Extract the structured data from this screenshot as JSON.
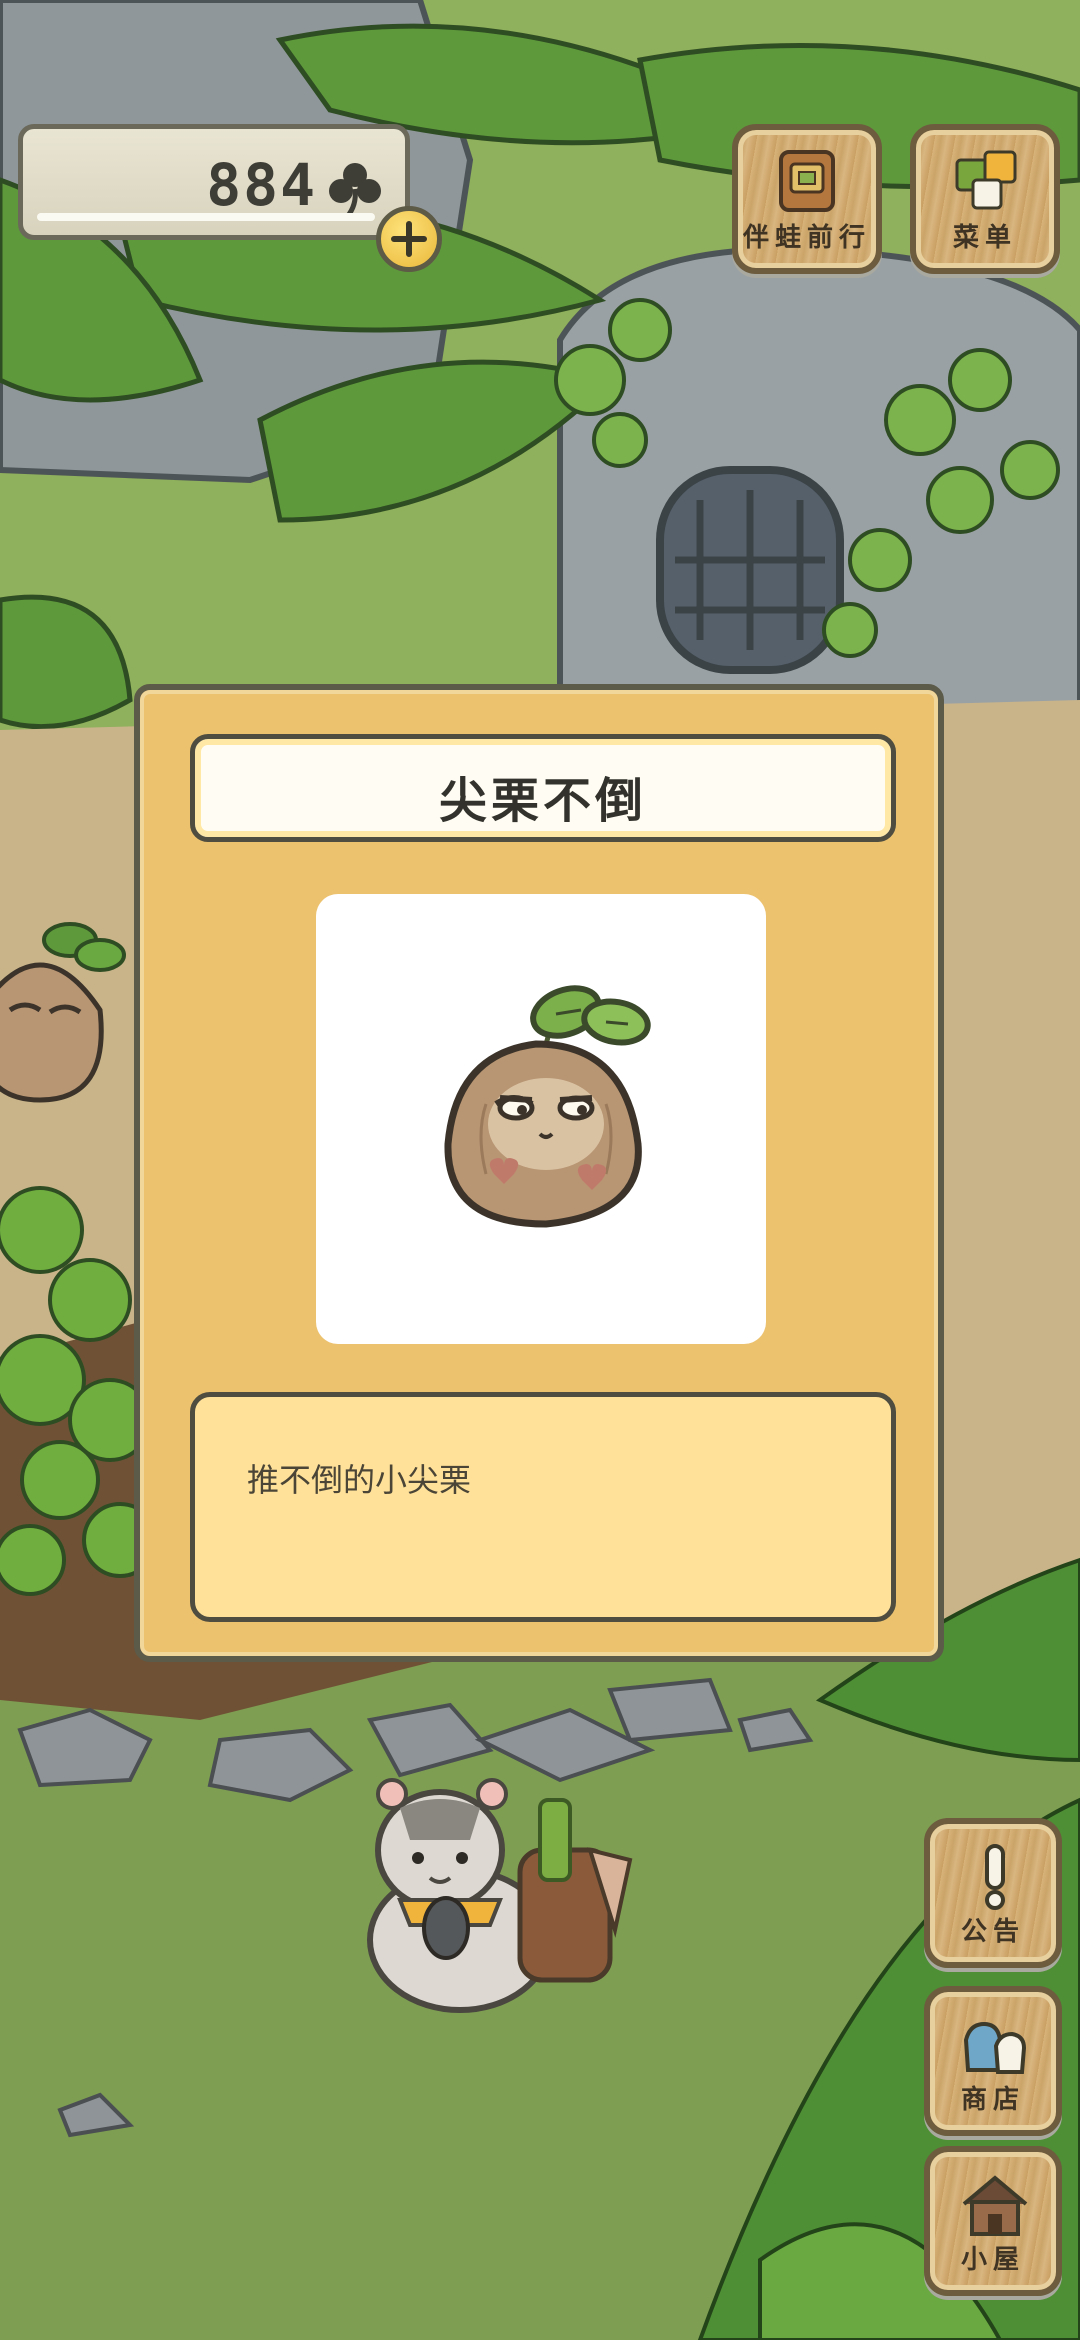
{
  "hud": {
    "clover_count": "884",
    "clover_icon": "clover-icon",
    "add_icon": "plus-icon"
  },
  "top_buttons": {
    "travel_label": "伴蛙前行",
    "menu_label": "菜单"
  },
  "side_buttons": {
    "notice_label": "公告",
    "shop_label": "商店",
    "house_label": "小屋"
  },
  "item_dialog": {
    "title": "尖栗不倒",
    "description": "推不倒的小尖栗",
    "item_icon": "chestnut-doll-icon"
  },
  "colors": {
    "dialog_bg": "#ecc26f",
    "desc_bg": "#ffe199",
    "accent_yellow": "#f4c94a",
    "leaf_green": "#5e9a3c"
  }
}
